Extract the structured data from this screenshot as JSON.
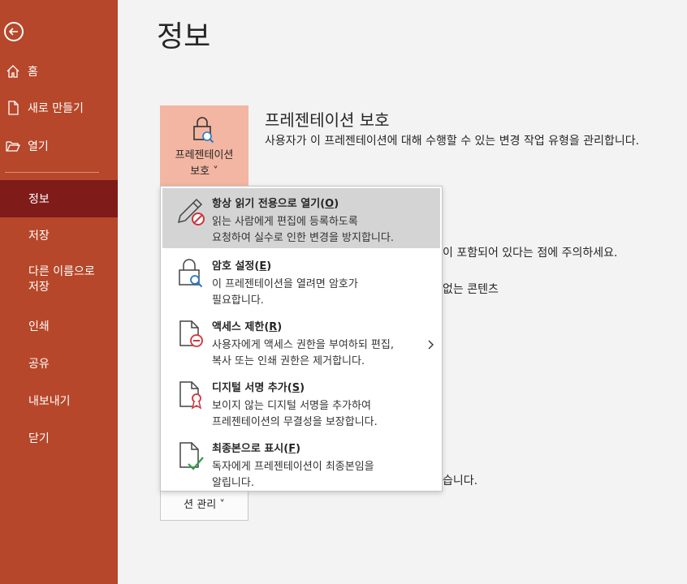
{
  "nav": {
    "items": [
      {
        "label": "홈",
        "icon": "home-icon"
      },
      {
        "label": "새로 만들기",
        "icon": "new-file-icon"
      },
      {
        "label": "열기",
        "icon": "folder-open-icon"
      },
      {
        "label": "정보",
        "active": true
      },
      {
        "label": "저장"
      },
      {
        "label": "다른 이름으로",
        "label2": "저장"
      },
      {
        "label": "인쇄"
      },
      {
        "label": "공유"
      },
      {
        "label": "내보내기"
      },
      {
        "label": "닫기"
      }
    ]
  },
  "page": {
    "title": "정보",
    "protect_button": {
      "line1": "프레젠테이션",
      "line2": "보호 ˅"
    },
    "section_title": "프레젠테이션 보호",
    "section_desc": "사용자가 이 프레젠테이션에 대해 수행할 수 있는 변경 작업 유형을 관리합니다.",
    "bg_text_1": "이 포함되어 있다는 점에 주의하세요.",
    "bg_text_2": "없는 콘텐츠",
    "bg_text_3": "습니다.",
    "manage_button": "션 관리 ˅"
  },
  "menu": {
    "items": [
      {
        "title": "항상 읽기 전용으로 열기",
        "key": "O",
        "desc1": "읽는 사람에게 편집에 등록하도록",
        "desc2": "요청하여 실수로 인한 변경을 방지합니다.",
        "icon": "pencil-prohibited-icon"
      },
      {
        "title": "암호 설정",
        "key": "E",
        "desc1": "이 프레젠테이션을 열려면 암호가",
        "desc2": "필요합니다.",
        "icon": "lock-key-icon"
      },
      {
        "title": "액세스 제한",
        "key": "R",
        "desc1": "사용자에게 액세스 권한을 부여하되 편집,",
        "desc2": "복사 또는 인쇄 권한은 제거합니다.",
        "icon": "document-restrict-icon"
      },
      {
        "title": "디지털 서명 추가",
        "key": "S",
        "desc1": "보이지 않는 디지털 서명을 추가하여",
        "desc2": "프레젠테이션의 무결성을 보장합니다.",
        "icon": "document-ribbon-icon"
      },
      {
        "title": "최종본으로 표시",
        "key": "F",
        "desc1": "독자에게 프레젠테이션이 최종본임을",
        "desc2": "알립니다.",
        "icon": "document-check-icon"
      }
    ]
  },
  "colors": {
    "sidebar": "#b7472a",
    "active_nav": "#7f1c19",
    "protect_button": "#f3b6a2",
    "hover": "#d4d4d4"
  }
}
